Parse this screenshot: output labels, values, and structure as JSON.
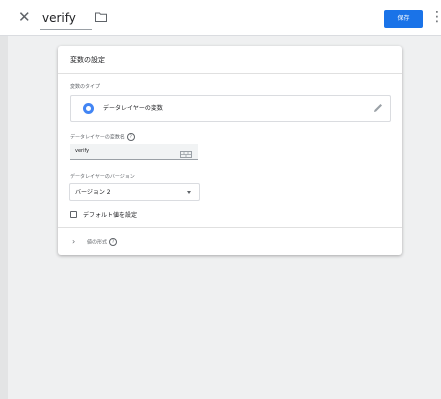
{
  "toolbar": {
    "title_value": "verify",
    "save_label": "保存",
    "close_icon": "close-icon",
    "folder_icon": "folder-icon",
    "more_icon": "more-vert-icon",
    "accent": "#1a73e8"
  },
  "card": {
    "title": "変数の設定",
    "variable_type_label": "変数のタイプ",
    "variable_type_name": "データレイヤーの変数",
    "variable_name_label": "データレイヤーの変数名",
    "variable_name_value": "verify",
    "version_label": "データレイヤーのバージョン",
    "version_value": "バージョン 2",
    "default_checkbox_label": "デフォルト値を設定",
    "value_format_label": "値の形式",
    "help_glyph": "?"
  }
}
